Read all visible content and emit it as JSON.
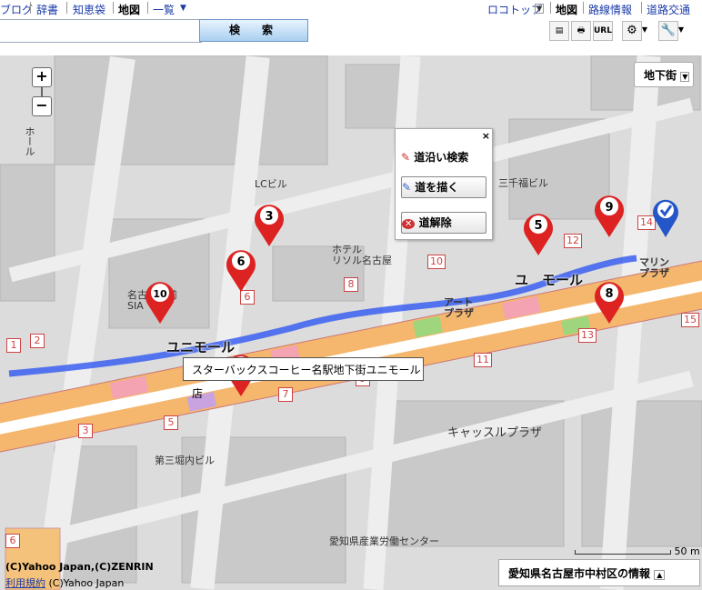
{
  "nav": {
    "items": [
      "ブログ",
      "辞書",
      "知恵袋",
      "地図",
      "一覧"
    ],
    "right_links": [
      "ロコトップ",
      "地図",
      "路線情報",
      "道路交通"
    ]
  },
  "search": {
    "button_label": "検　索",
    "value": ""
  },
  "toolbar": {
    "url_label": "URL"
  },
  "map": {
    "layer_button": "地下街",
    "popup": {
      "title": "道沿い検索",
      "draw_button": "道を描く",
      "clear_button": "道解除"
    },
    "tooltip": "スターバックスコーヒー名駅地下街ユニモール店",
    "labels": {
      "unimall_left": "ユニモール",
      "unimall_right": "ユ　モール",
      "marine_plaza": "マリン\nプラザ",
      "art_plaza": "アート\nプラザ",
      "hotel": "ホテル\nリソル名古屋",
      "castle_plaza": "キャッスルプラザ",
      "lc_bldg": "LCビル",
      "sanchifuku": "三千福ビル",
      "sanchihori": "第三堀内ビル",
      "aichi_center": "愛知県産業労働センター",
      "meitetsu": "名古屋駅前\nSIA",
      "hall": "ホール"
    },
    "markers": [
      "1",
      "3",
      "5",
      "6",
      "8",
      "9",
      "10"
    ],
    "copyright": "(C)Yahoo Japan,(C)ZENRIN",
    "terms": "利用規約",
    "copyright2": "(C)Yahoo Japan",
    "area_info": "愛知県名古屋市中村区の情報",
    "scale_label": "50 m",
    "square_numbers": [
      "1",
      "2",
      "3",
      "5",
      "6",
      "7",
      "8",
      "9",
      "10",
      "11",
      "12",
      "13",
      "14",
      "15",
      "6"
    ]
  }
}
